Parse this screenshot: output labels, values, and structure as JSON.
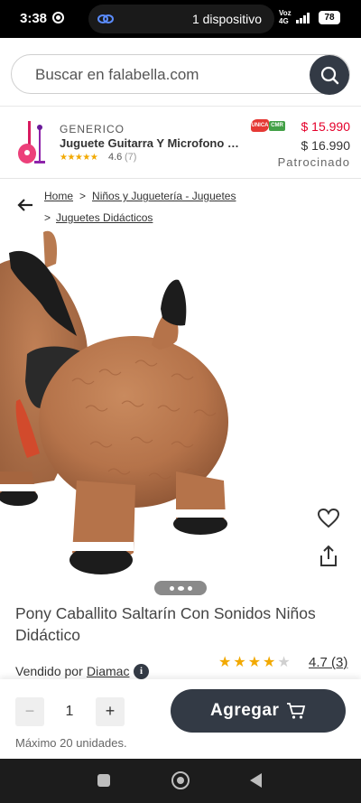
{
  "status_bar": {
    "time": "3:38",
    "device_pill": "1 dispositivo",
    "network_top": "Voz",
    "network_bottom": "4G",
    "network_mid": "4G",
    "battery": "78"
  },
  "search": {
    "placeholder": "Buscar en falabella.com"
  },
  "sponsored_product": {
    "brand": "GENERICO",
    "title": "Juguete Guitarra Y Microfono Mu...",
    "stars": "★★★★★",
    "rating": "4.6",
    "review_count": "(7)",
    "badge_unica": "UNICA",
    "badge_cmr": "CMR",
    "price_cmr": "$ 15.990",
    "price_normal": "$ 16.990",
    "sponsored_label": "Patrocinado"
  },
  "breadcrumb": {
    "items": [
      "Home",
      "Niños y Juguetería - Juguetes",
      "Juguetes Didácticos"
    ],
    "separator": ">"
  },
  "product": {
    "title": "Pony Caballito Saltarín Con Sonidos Niños Didáctico",
    "rating": "4.7 (3)",
    "rating_value": 4.7,
    "stars_full": 4,
    "stars_total": 5,
    "seller_label": "Vendido por",
    "seller_name": "Diamac",
    "info_glyph": "i",
    "carousel_dots": 3,
    "carousel_active": 1
  },
  "purchase": {
    "minus": "−",
    "quantity": "1",
    "plus": "+",
    "max_units": "Máximo 20 unidades.",
    "add_label": "Agregar"
  },
  "colors": {
    "primary_dark": "#333a45",
    "price_red": "#e4002b",
    "star_gold": "#f2a900",
    "cmr_green": "#43a047"
  },
  "icons": {
    "search": "search-icon",
    "favorite": "heart-icon",
    "share": "share-icon",
    "back": "arrow-left-icon",
    "cart": "cart-icon"
  }
}
